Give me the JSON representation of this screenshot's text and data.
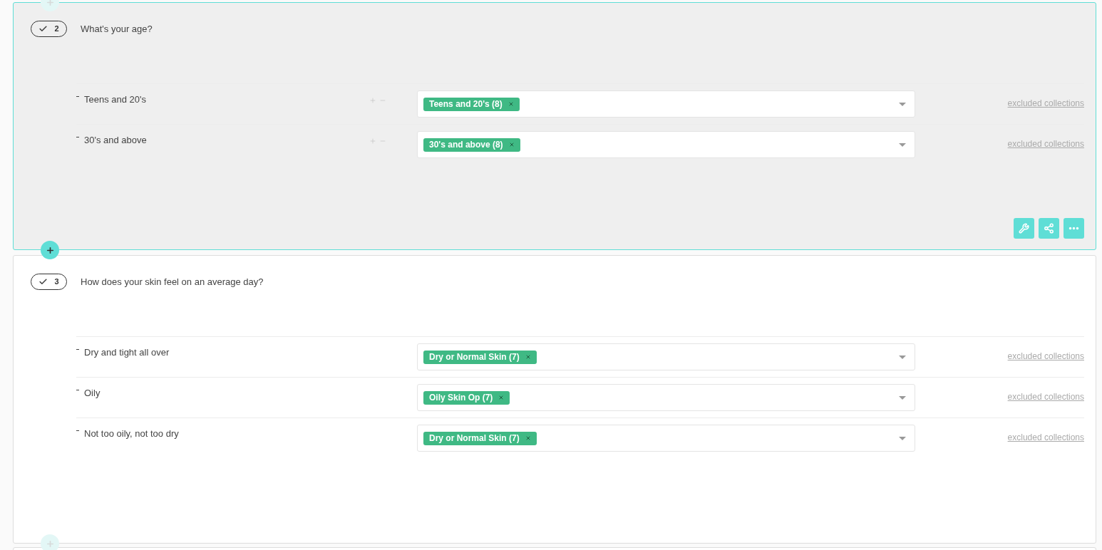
{
  "inserters": [
    {
      "active": false
    },
    {
      "active": true
    },
    {
      "active": false
    }
  ],
  "questions": [
    {
      "number": "2",
      "text": "What's your age?",
      "selected": true,
      "reorder_controls": true,
      "options": [
        {
          "label": "Teens and 20's",
          "tags": [
            "Teens and 20's (8)"
          ],
          "link": "excluded collections"
        },
        {
          "label": "30's and above",
          "tags": [
            "30's and above (8)"
          ],
          "link": "excluded collections"
        }
      ]
    },
    {
      "number": "3",
      "text": "How does your skin feel on an average day?",
      "selected": false,
      "reorder_controls": false,
      "options": [
        {
          "label": "Dry and tight all over",
          "tags": [
            "Dry or Normal Skin (7)"
          ],
          "link": "excluded collections"
        },
        {
          "label": "Oily",
          "tags": [
            "Oily Skin Op (7)"
          ],
          "link": "excluded collections"
        },
        {
          "label": "Not too oily, not too dry",
          "tags": [
            "Dry or Normal Skin (7)"
          ],
          "link": "excluded collections"
        }
      ]
    }
  ]
}
